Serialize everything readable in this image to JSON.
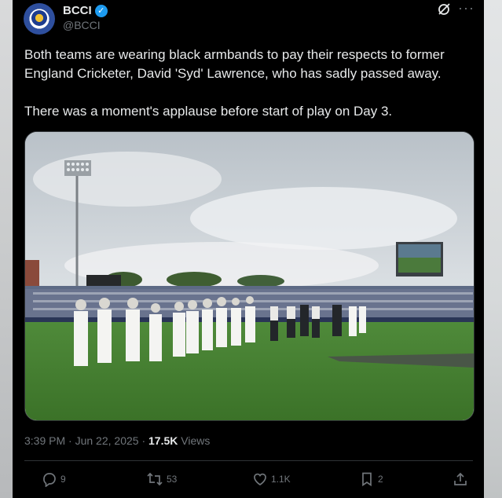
{
  "account": {
    "name": "BCCI",
    "handle": "@BCCI",
    "verified_color": "#1d9bf0",
    "avatar_icon": "bcci-logo"
  },
  "tweet": {
    "text_1": "Both teams are wearing black armbands to pay their respects to former England Cricketer, David 'Syd' Lawrence, who has sadly passed away.",
    "text_2": "There was a moment's applause before start of play on Day 3.",
    "image_alt_icon": "cricket-stadium-photo"
  },
  "meta": {
    "time": "3:39 PM",
    "separator": "·",
    "date": "Jun 22, 2025",
    "views_count": "17.5K",
    "views_label": "Views"
  },
  "actions": {
    "replies": "9",
    "reposts": "53",
    "likes": "1.1K",
    "bookmarks": "2"
  },
  "colors": {
    "background": "#000000",
    "text": "#e7e9ea",
    "muted": "#71767b",
    "accent": "#1d9bf0"
  }
}
